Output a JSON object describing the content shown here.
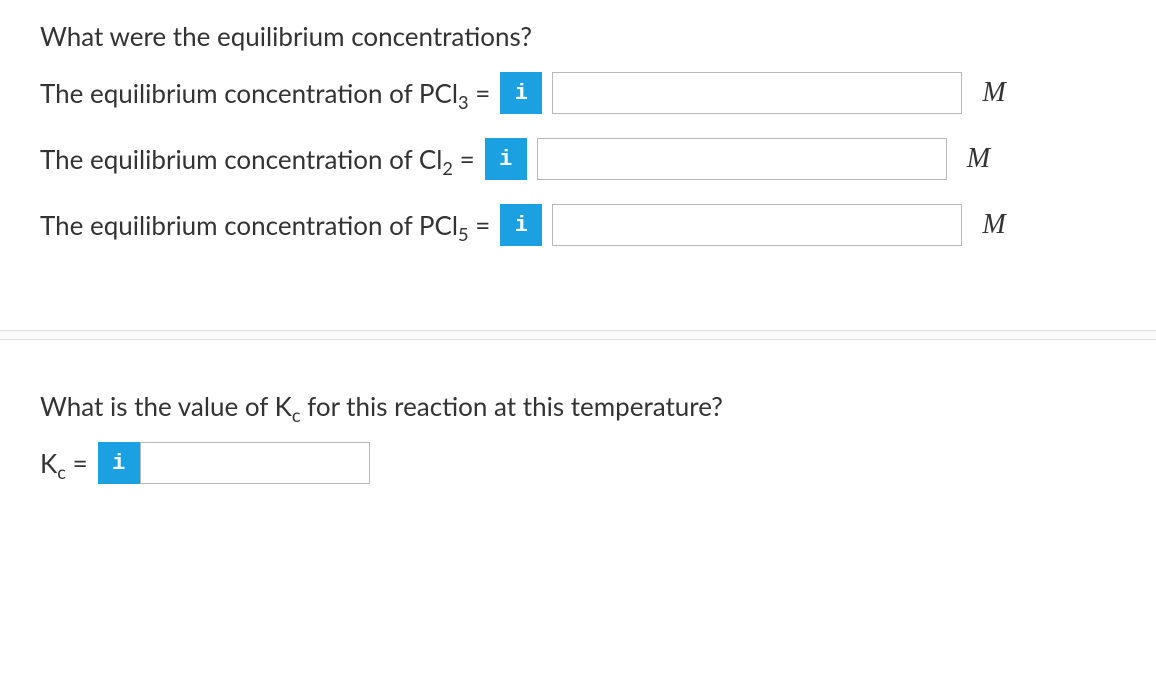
{
  "section1": {
    "title": "What were the equilibrium concentrations?",
    "rows": [
      {
        "label_pre": "The equilibrium concentration of PCl",
        "label_sub": "3",
        "label_post": " =",
        "unit": "M",
        "value": ""
      },
      {
        "label_pre": "The equilibrium concentration of Cl",
        "label_sub": "2",
        "label_post": " =",
        "unit": "M",
        "value": ""
      },
      {
        "label_pre": "The equilibrium concentration of PCl",
        "label_sub": "5",
        "label_post": " =",
        "unit": "M",
        "value": ""
      }
    ]
  },
  "section2": {
    "title_pre": "What is the value of K",
    "title_sub": "c",
    "title_post": " for this reaction at this temperature?",
    "kc_label_pre": "K",
    "kc_label_sub": "c",
    "kc_label_post": " =",
    "value": ""
  },
  "info_glyph": "i"
}
